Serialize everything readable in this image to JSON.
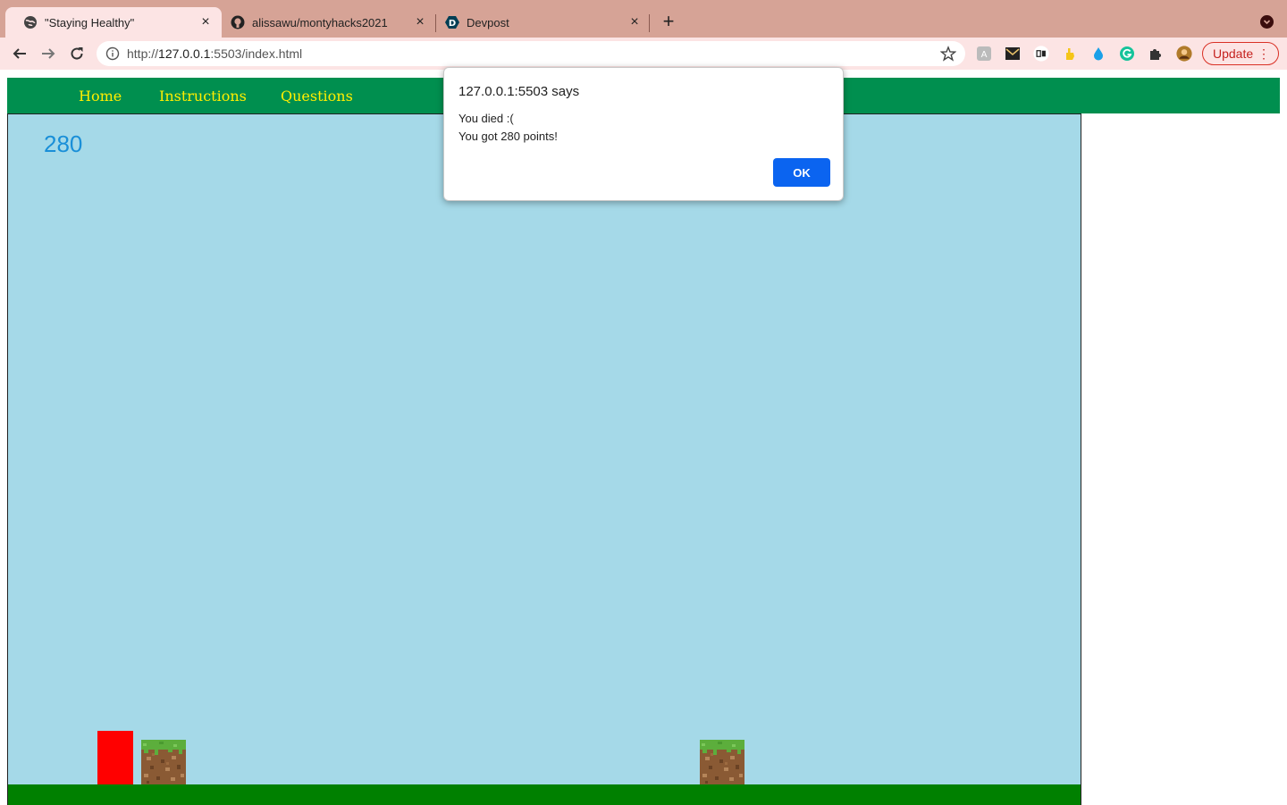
{
  "browser": {
    "tabs": [
      {
        "title": "\"Staying Healthy\"",
        "favicon": "globe-icon",
        "active": true
      },
      {
        "title": "alissawu/montyhacks2021",
        "favicon": "github-icon",
        "active": false
      },
      {
        "title": "Devpost",
        "favicon": "devpost-icon",
        "active": false
      }
    ],
    "url_prefix": "http://",
    "url_host": "127.0.0.1",
    "url_rest": ":5503/index.html",
    "update_label": "Update"
  },
  "page": {
    "nav": [
      "Home",
      "Instructions",
      "Questions"
    ],
    "score": "280"
  },
  "dialog": {
    "title": "127.0.0.1:5503 says",
    "line1": "You died :(",
    "line2": "You got 280 points!",
    "ok_label": "OK"
  },
  "colors": {
    "tabstrip": "#d6a396",
    "toolbar": "#fce4e4",
    "nav_bg": "#008f4f",
    "nav_text": "#ffee00",
    "sky": "#a5d9e8",
    "ground": "#008000",
    "player": "#ff0000",
    "score": "#1a8fd8",
    "ok_button": "#0b64f0"
  }
}
